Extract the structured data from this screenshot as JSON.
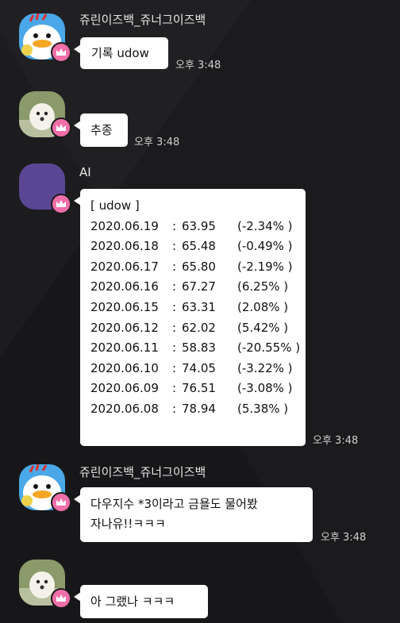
{
  "messages": [
    {
      "sender": "쥬린이즈백_쥬너그이즈백",
      "text": "기록 udow",
      "time": "오후 3:48"
    },
    {
      "text": "추종",
      "time": "오후 3:48"
    },
    {
      "sender": "AI",
      "time": "오후 3:48",
      "header": "[ udow ]",
      "records": [
        {
          "date": "2020.06.19",
          "value": "63.95",
          "change": "(-2.34% )"
        },
        {
          "date": "2020.06.18",
          "value": "65.48",
          "change": "(-0.49% )"
        },
        {
          "date": "2020.06.17",
          "value": "65.80",
          "change": "(-2.19% )"
        },
        {
          "date": "2020.06.16",
          "value": "67.27",
          "change": "(6.25% )"
        },
        {
          "date": "2020.06.15",
          "value": "63.31",
          "change": "(2.08% )"
        },
        {
          "date": "2020.06.12",
          "value": "62.02",
          "change": "(5.42% )"
        },
        {
          "date": "2020.06.11",
          "value": "58.83",
          "change": "(-20.55% )"
        },
        {
          "date": "2020.06.10",
          "value": "74.05",
          "change": "(-3.22% )"
        },
        {
          "date": "2020.06.09",
          "value": "76.51",
          "change": "(-3.08% )"
        },
        {
          "date": "2020.06.08",
          "value": "78.94",
          "change": "(5.38% )"
        }
      ]
    },
    {
      "sender": "쥬린이즈백_쥬너그이즈백",
      "text_line1": "다우지수 *3이라고 금욜도 물어봤",
      "text_line2": "자나유!!ㅋㅋㅋ",
      "time": "오후 3:48"
    },
    {
      "text": "아 그랬나 ㅋㅋㅋ"
    }
  ],
  "colors": {
    "background": "#1b1b1d",
    "bubble": "#ffffff",
    "crown_badge": "#f06fa8",
    "ai_avatar": "#5b4694"
  },
  "icons": [
    "duck-avatar",
    "puppy-avatar",
    "crown-icon"
  ]
}
